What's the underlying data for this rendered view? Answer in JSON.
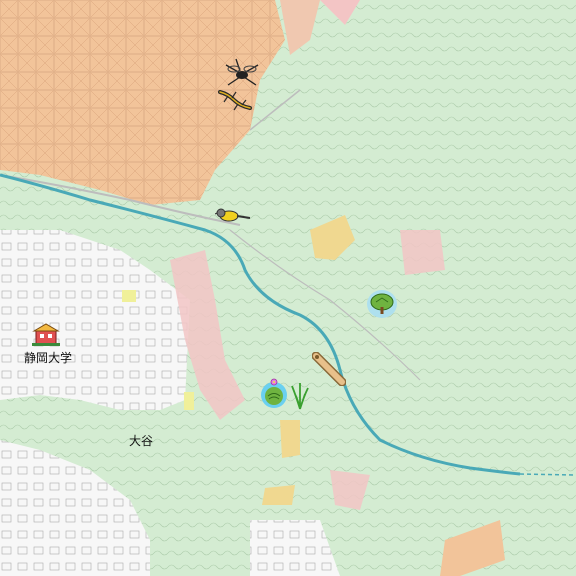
{
  "map": {
    "labels": {
      "university": "静岡大学",
      "oya": "大谷"
    },
    "colors": {
      "forest": "#cfe9cd",
      "farmland": "#f2c49a",
      "urban": "#ffffff",
      "river": "#49a9b7",
      "orchard": "#f0f09a",
      "bare": "#f3c5c5"
    },
    "markers": [
      {
        "icon": "university-icon"
      },
      {
        "icon": "insect-icon"
      },
      {
        "icon": "lizard-icon"
      },
      {
        "icon": "bird-icon"
      },
      {
        "icon": "tree-icon"
      },
      {
        "icon": "caterpillar-icon"
      },
      {
        "icon": "plant-icon"
      },
      {
        "icon": "grass-icon"
      }
    ]
  }
}
